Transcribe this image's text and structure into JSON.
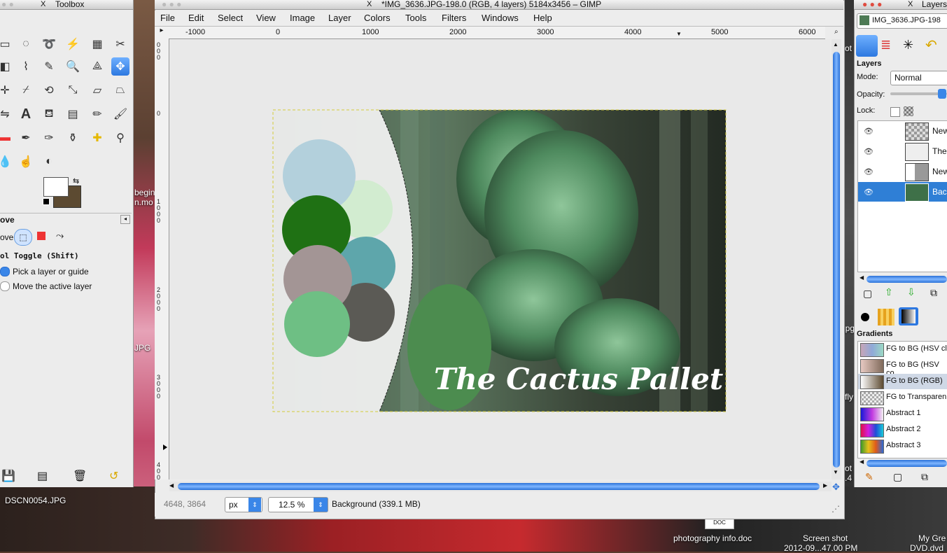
{
  "toolbox": {
    "title": "Toolbox",
    "move_section": "ove",
    "move_label": "ove:",
    "toggle_label": "ol Toggle  (Shift)",
    "option1": "Pick a layer or guide",
    "option2": "Move the active layer"
  },
  "image_window": {
    "title": "*IMG_3636.JPG-198.0 (RGB, 4 layers) 5184x3456 – GIMP",
    "menu": [
      "File",
      "Edit",
      "Select",
      "View",
      "Image",
      "Layer",
      "Colors",
      "Tools",
      "Filters",
      "Windows",
      "Help"
    ],
    "ruler_labels": [
      "-1000",
      "0",
      "1000",
      "2000",
      "3000",
      "4000",
      "5000",
      "6000"
    ],
    "canvas_text": "The Cactus Pallet",
    "status": {
      "coords": "4648, 3864",
      "unit": "px",
      "zoom": "12.5 %",
      "layer_info": "Background (339.1 MB)"
    },
    "palette": {
      "colors": [
        "#b3d0dc",
        "#d2ecd0",
        "#1f7114",
        "#5ea6ab",
        "#a39595",
        "#5b5a55",
        "#6ebf84"
      ]
    }
  },
  "layers_panel": {
    "title": "Layers",
    "image_selector": "IMG_3636.JPG-198",
    "section": "Layers",
    "mode_label": "Mode:",
    "mode_value": "Normal",
    "opacity_label": "Opacity:",
    "lock_label": "Lock:",
    "layers": [
      {
        "name": "New",
        "selected": false
      },
      {
        "name": "The",
        "selected": false
      },
      {
        "name": "New",
        "selected": false
      },
      {
        "name": "Bac",
        "selected": true
      }
    ],
    "gradients_label": "Gradients",
    "gradients": [
      {
        "name": "FG to BG (HSV cl",
        "selected": false
      },
      {
        "name": "FG to BG (HSV co",
        "selected": false
      },
      {
        "name": "FG to BG (RGB)",
        "selected": true
      },
      {
        "name": "FG to Transparen",
        "selected": false
      },
      {
        "name": "Abstract 1",
        "selected": false
      },
      {
        "name": "Abstract 2",
        "selected": false
      },
      {
        "name": "Abstract 3",
        "selected": false
      }
    ]
  },
  "desktop": {
    "labels": {
      "dscn": "DSCN0054.JPG",
      "photo_doc": "photography info.doc",
      "screenshot": "Screen shot",
      "screenshot_date": "2012-09...47.00 PM",
      "my_gre": "My Gre",
      "dvd": "DVD.dvd",
      "begin": "begin",
      "nmo": "n.mo",
      "jpg": "JPG",
      "jpg2": "jpg",
      "fly": "fly",
      "ot": "ot",
      "ot2": "ot",
      "four": ".4",
      "doc_icon": "DOC"
    }
  }
}
